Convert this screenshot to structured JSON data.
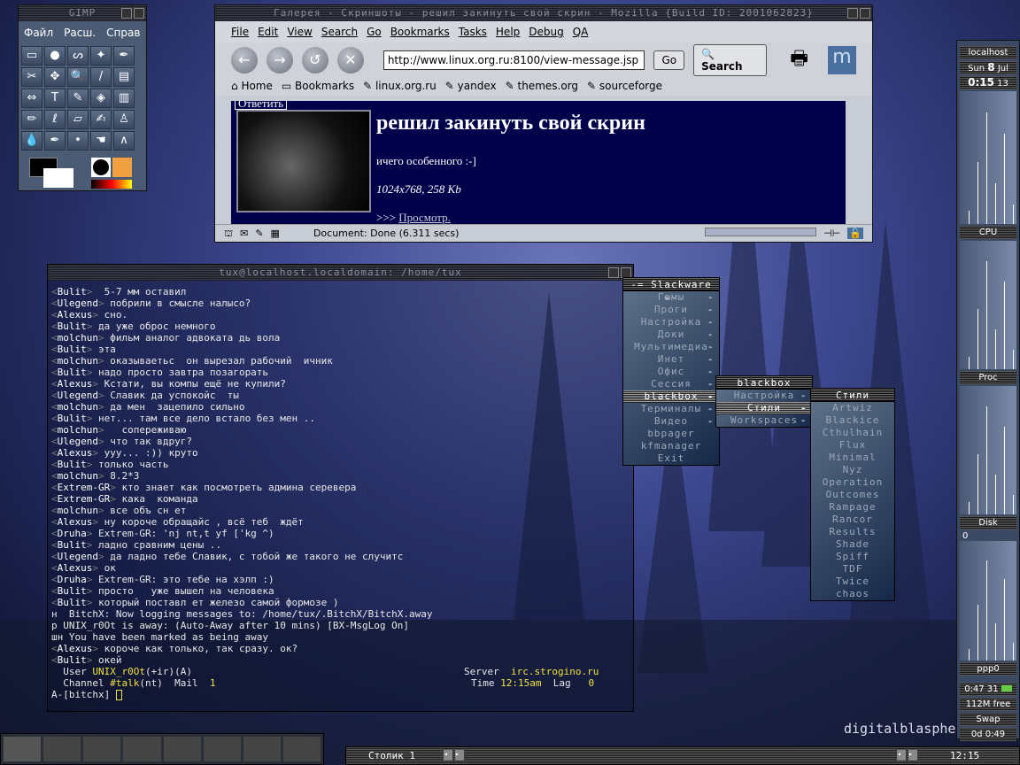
{
  "gimp": {
    "title": "GIMP",
    "menu": [
      "Файл",
      "Расш.",
      "Справ"
    ],
    "tools": [
      "▭",
      "●",
      "ᔕ",
      "✦",
      "✒",
      "✂",
      "✥",
      "🔍",
      "/",
      "▤",
      "⇔",
      "T",
      "✎",
      "◈",
      "▥",
      "✏",
      "ℓ",
      "▱",
      "✍",
      "♙",
      "💧",
      "✒",
      "•",
      "☚",
      "∧"
    ]
  },
  "mozilla": {
    "title": "Галерея - Скриншоты - решил закинуть свой скрин - Mozilla {Build ID: 2001062823}",
    "menu": [
      "File",
      "Edit",
      "View",
      "Search",
      "Go",
      "Bookmarks",
      "Tasks",
      "Help",
      "Debug",
      "QA"
    ],
    "url": "http://www.linux.org.ru:8100/view-message.jsp",
    "go": "Go",
    "search": "Search",
    "bookmarks": [
      "Home",
      "Bookmarks",
      "linux.org.ru",
      "yandex",
      "themes.org",
      "sourceforge"
    ],
    "content": {
      "reply": "Ответить",
      "heading": "решил закинуть свой скрин",
      "text": "ичего особенного :-]",
      "meta": "1024x768, 258 Kb",
      "link_prefix": ">>> ",
      "link": "Просмотр."
    },
    "status": "Document: Done (6.311 secs)"
  },
  "terminal": {
    "title": "tux@localhost.localdomain: /home/tux",
    "lines": [
      [
        "Bulit",
        " 5-7 мм оставил"
      ],
      [
        "Ulegend",
        "побрили в смысле налысо?"
      ],
      [
        "Alexus",
        "сно."
      ],
      [
        "Bulit",
        "да уже оброс немного"
      ],
      [
        "molchun",
        "фильм аналог адвоката дь вола"
      ],
      [
        "Bulit",
        "эта"
      ],
      [
        "molchun",
        "оказываетьс  он вырезал рабочий  ичник"
      ],
      [
        "Bulit",
        "надо просто завтра позагорать"
      ],
      [
        "Alexus",
        "Кстати, вы компы ещё не купили?"
      ],
      [
        "Ulegend",
        "Славик да успокойс  ты"
      ],
      [
        "molchun",
        "да мен  зацепило сильно"
      ],
      [
        "Bulit",
        "нет... там все дело встало без мен .."
      ],
      [
        "molchun",
        "  сопереживаю"
      ],
      [
        "Ulegend",
        "что так вдруг?"
      ],
      [
        "Alexus",
        "ууу... :)) круто"
      ],
      [
        "Bulit",
        "только часть"
      ],
      [
        "molchun",
        "8.2*3"
      ],
      [
        "Extrem-GR",
        "кто знает как посмотреть админа серевера"
      ],
      [
        "Extrem-GR",
        "кака  команда"
      ],
      [
        "molchun",
        "все объ сн ет"
      ],
      [
        "Alexus",
        "ну короче обращайс , всё теб  ждёт"
      ],
      [
        "Druha",
        "Extrem-GR: 'nj nt,t yf ['kg ^)"
      ],
      [
        "Bulit",
        "ладно сравним цены .."
      ],
      [
        "Ulegend",
        "да ладно тебе Славик, с тобой же такого не случитс"
      ],
      [
        "Alexus",
        "ок"
      ],
      [
        "Druha",
        "Extrem-GR: это тебе на хэлп :)"
      ],
      [
        "Bulit",
        "просто   уже вышел на человека"
      ],
      [
        "Bulit",
        "который поставл ет железо самой формозе )"
      ]
    ],
    "system": [
      "н  BitchX: Now logging messages to: /home/tux/.BitchX/BitchX.away",
      "р UNIX_r0Ot is away: (Auto-Away after 10 mins) [BX-MsgLog On]",
      "шн You have been marked as being away"
    ],
    "lines2": [
      [
        "Alexus",
        "короче как только, так сразу. ок?"
      ],
      [
        "Bulit",
        "окей"
      ]
    ],
    "status1": {
      "user_label": "User",
      "user": "UNIX_r0Ot",
      "modes": "(+ir)(A)",
      "server_label": "Server",
      "server": "irc.strogino.ru"
    },
    "status2": {
      "channel_label": "Channel",
      "channel": "#talk",
      "cmodes": "(nt)",
      "mail_label": "Mail",
      "mail": "1",
      "time_label": "Time",
      "time": "12:15am",
      "lag_label": "Lag",
      "lag": "0"
    },
    "prompt": "A-[bitchx]"
  },
  "menus": {
    "slackware": {
      "title": "-= Slackware =-",
      "items": [
        "Гамы",
        "Проги",
        "Настройка",
        "Доки",
        "Мультимедиа",
        "Инет",
        "Офис",
        "Сессия",
        "blackbox",
        "Терминалы",
        "Видео",
        "bbpager",
        "kfmanager",
        "Exit"
      ],
      "submenu": [
        1,
        1,
        1,
        1,
        1,
        1,
        1,
        1,
        1,
        1,
        1,
        0,
        0,
        0
      ]
    },
    "blackbox": {
      "title": "blackbox",
      "items": [
        "Настройка",
        "Стили",
        "Workspaces"
      ]
    },
    "styles": {
      "title": "Стили",
      "items": [
        "Artwiz",
        "Blackice",
        "Cthulhain",
        "Flux",
        "Minimal",
        "Nyz",
        "Operation",
        "Outcomes",
        "Rampage",
        "Rancor",
        "Results",
        "Shade",
        "Spiff",
        "TDF",
        "Twice",
        "chaos"
      ]
    }
  },
  "panel": {
    "host": "localhost",
    "day": "Sun",
    "date": "8",
    "month": "Jul",
    "time": "0:15",
    "seconds": "13",
    "cpu": "CPU",
    "proc": "Proc",
    "disk": "Disk",
    "disk_value": "0",
    "net": "ppp0",
    "conn_time": "0:47",
    "conn_sec": "31",
    "mem": "112M free",
    "swap": "Swap",
    "uptime": "0d  0:49"
  },
  "wallpaper_text": "digitalblasphe",
  "taskbar": {
    "workspace": "Столик 1",
    "clock": "12:15"
  }
}
